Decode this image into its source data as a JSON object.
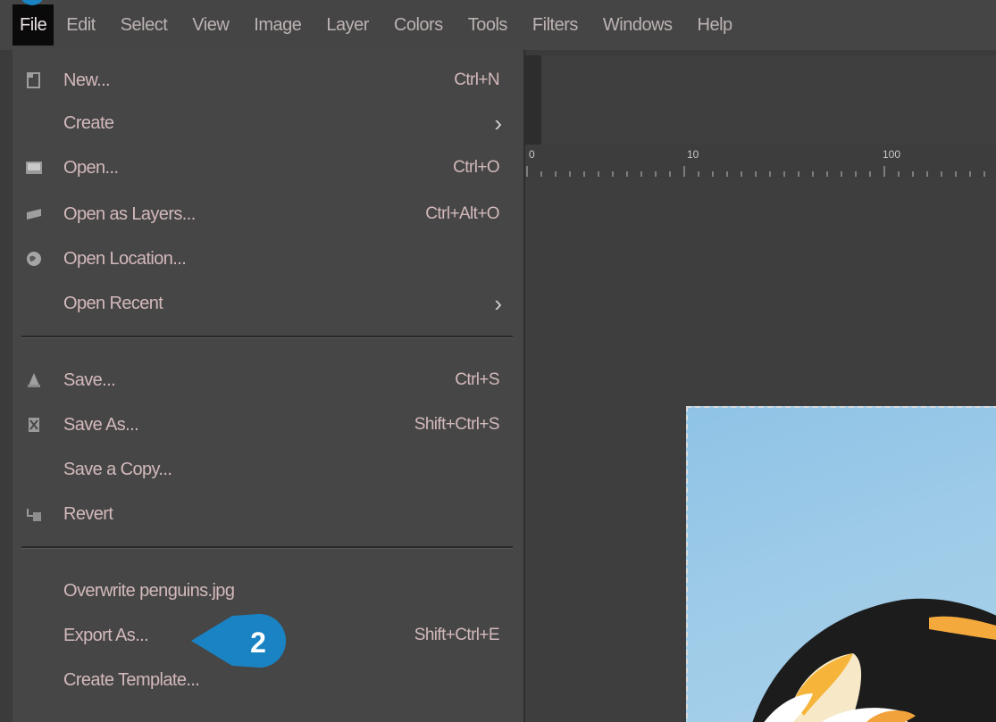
{
  "menubar": {
    "items": [
      "File",
      "Edit",
      "Select",
      "View",
      "Image",
      "Layer",
      "Colors",
      "Tools",
      "Filters",
      "Windows",
      "Help"
    ]
  },
  "file_menu": {
    "new": {
      "label": "New...",
      "shortcut": "Ctrl+N"
    },
    "create": {
      "label": "Create"
    },
    "open": {
      "label": "Open...",
      "shortcut": "Ctrl+O"
    },
    "open_as_layers": {
      "label": "Open as Layers...",
      "shortcut": "Ctrl+Alt+O"
    },
    "open_location": {
      "label": "Open Location..."
    },
    "open_recent": {
      "label": "Open Recent"
    },
    "save": {
      "label": "Save...",
      "shortcut": "Ctrl+S"
    },
    "save_as": {
      "label": "Save As...",
      "shortcut": "Shift+Ctrl+S"
    },
    "save_copy": {
      "label": "Save a Copy..."
    },
    "revert": {
      "label": "Revert"
    },
    "overwrite": {
      "label": "Overwrite penguins.jpg"
    },
    "export_as": {
      "label": "Export As...",
      "shortcut": "Shift+Ctrl+E"
    },
    "create_template": {
      "label": "Create Template..."
    }
  },
  "ruler": {
    "labels": [
      "0",
      "10",
      "100"
    ]
  },
  "callout": {
    "number": "2",
    "color": "#1a83c4"
  },
  "colors": {
    "menu_text": "#d3b9bb",
    "menu_bg": "#464646",
    "menubar_active_bg": "#0a0a0a",
    "accent": "#1a83c4"
  }
}
